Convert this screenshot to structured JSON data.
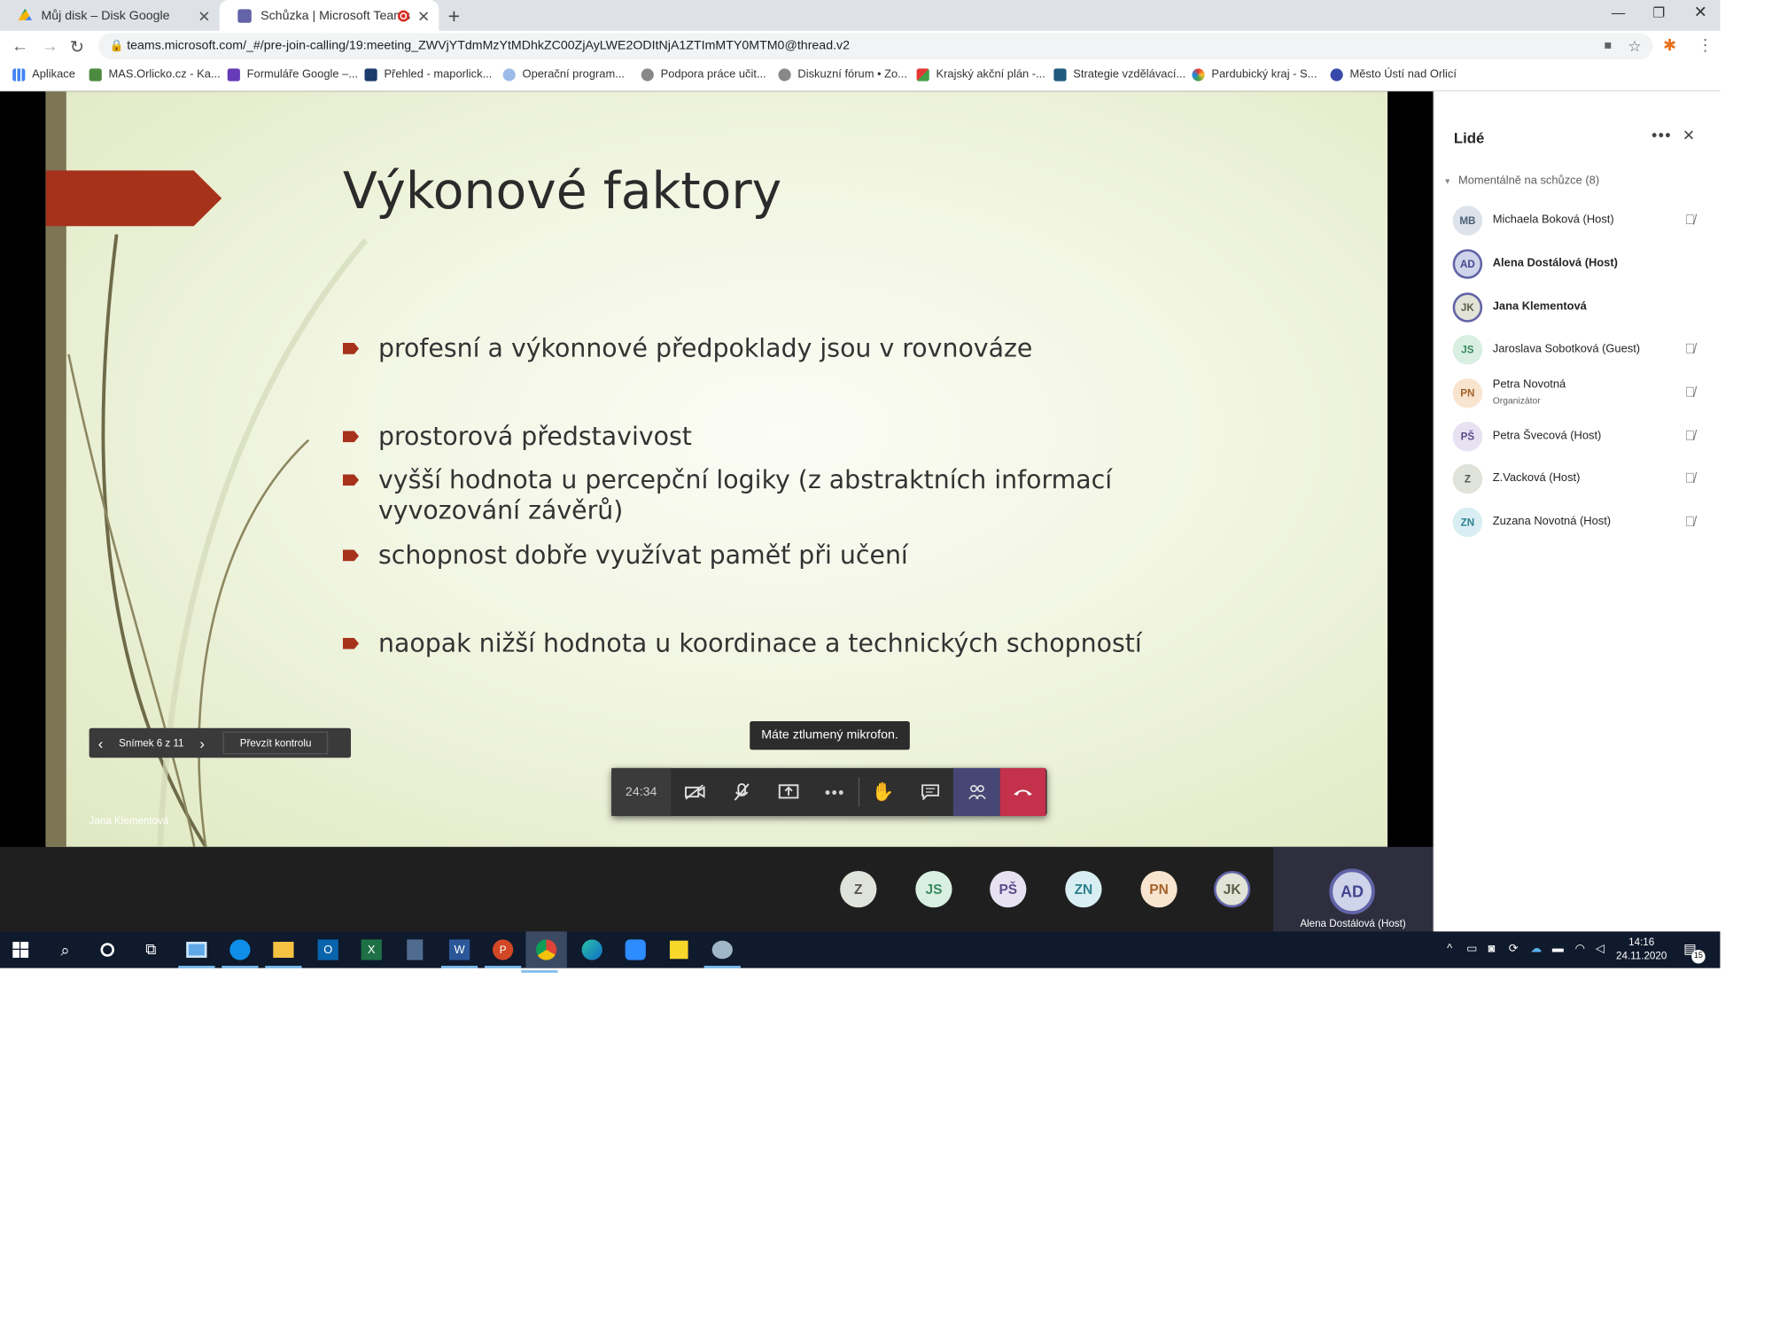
{
  "browser": {
    "tabs": [
      {
        "title": "Můj disk – Disk Google",
        "active": false
      },
      {
        "title": "Schůzka | Microsoft Teams",
        "active": true
      }
    ],
    "url": "teams.microsoft.com/_#/pre-join-calling/19:meeting_ZWVjYTdmMzYtMDhkZC00ZjAyLWE2ODItNjA1ZTImMTY0MTM0@thread.v2",
    "bookmarks": [
      "Aplikace",
      "MAS.Orlicko.cz - Ka...",
      "Formuláře Google –...",
      "Přehled - maporlick...",
      "Operační program...",
      "Podpora práce učit...",
      "Diskuzní fórum • Zo...",
      "Krajský akční plán -...",
      "Strategie vzdělávací...",
      "Pardubický kraj - S...",
      "Město Ústí nad Orlicí"
    ]
  },
  "slide": {
    "title": "Výkonové faktory",
    "bullets": [
      "profesní a výkonnové předpoklady jsou v rovnováze",
      "prostorová představivost",
      "vyšší hodnota u percepční logiky (z abstraktních informací vyvozování závěrů)",
      "schopnost dobře využívat paměť při učení",
      "naopak  nižší hodnota u koordinace a technických schopností"
    ],
    "counter": "Snímek 6 z 11",
    "take_control": "Převzít kontrolu",
    "presenter": "Jana Klementová",
    "accent_color": "#a6321c"
  },
  "call": {
    "timer": "24:34",
    "mute_tooltip": "Máte ztlumený mikrofon.",
    "tray": [
      "Z",
      "JS",
      "PŠ",
      "ZN",
      "PN",
      "JK"
    ],
    "self_initials": "AD",
    "self_name": "Alena Dostálová (Host)"
  },
  "people": {
    "title": "Lidé",
    "section": "Momentálně na schůzce (8)",
    "participants": [
      {
        "initials": "MB",
        "name": "Michaela Boková (Host)",
        "muted": true
      },
      {
        "initials": "AD",
        "name": "Alena Dostálová (Host)",
        "muted": false
      },
      {
        "initials": "JK",
        "name": "Jana Klementová",
        "muted": false
      },
      {
        "initials": "JS",
        "name": "Jaroslava Sobotková (Guest)",
        "muted": true
      },
      {
        "initials": "PN",
        "name": "Petra Novotná",
        "role": "Organizátor",
        "muted": true
      },
      {
        "initials": "PŠ",
        "name": "Petra Švecová (Host)",
        "muted": true
      },
      {
        "initials": "Z",
        "name": "Z.Vacková (Host)",
        "muted": true
      },
      {
        "initials": "ZN",
        "name": "Zuzana Novotná (Host)",
        "muted": true
      }
    ]
  },
  "taskbar": {
    "time": "14:16",
    "date": "24.11.2020",
    "notifications": "15"
  }
}
